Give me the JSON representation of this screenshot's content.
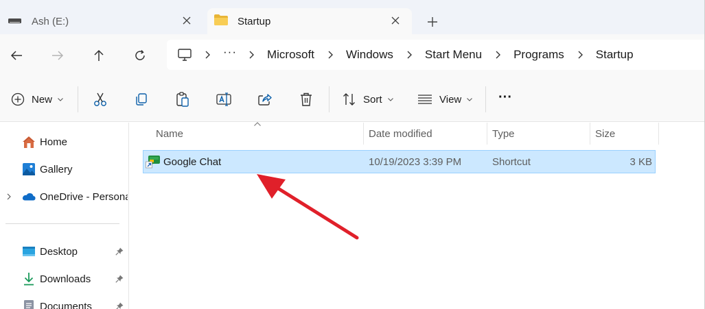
{
  "tabs": [
    {
      "label": "Ash (E:)",
      "icon": "drive-icon",
      "active": false
    },
    {
      "label": "Startup",
      "icon": "folder-icon",
      "active": true
    }
  ],
  "navigation": {
    "back": "back-arrow-icon",
    "forward": "forward-arrow-icon",
    "up": "up-arrow-icon",
    "refresh": "refresh-icon"
  },
  "breadcrumb": {
    "root_icon": "monitor-icon",
    "more": "···",
    "items": [
      "Microsoft",
      "Windows",
      "Start Menu",
      "Programs",
      "Startup"
    ]
  },
  "toolbar": {
    "new_label": "New",
    "sort_label": "Sort",
    "view_label": "View",
    "more_label": "···",
    "icons": [
      "cut-icon",
      "copy-icon",
      "paste-icon",
      "rename-icon",
      "share-icon",
      "delete-icon"
    ]
  },
  "sidebar": {
    "items": [
      {
        "label": "Home",
        "icon": "home-icon"
      },
      {
        "label": "Gallery",
        "icon": "gallery-icon"
      },
      {
        "label": "OneDrive - Persona",
        "icon": "onedrive-icon"
      },
      {
        "label": "Desktop",
        "icon": "desktop-icon",
        "pinned": true
      },
      {
        "label": "Downloads",
        "icon": "download-icon",
        "pinned": true
      },
      {
        "label": "Documents",
        "icon": "documents-icon",
        "pinned": true
      }
    ]
  },
  "columns": {
    "name": "Name",
    "date": "Date modified",
    "type": "Type",
    "size": "Size"
  },
  "files": [
    {
      "name": "Google Chat",
      "date": "10/19/2023 3:39 PM",
      "type": "Shortcut",
      "size": "3 KB",
      "selected": true
    }
  ],
  "colors": {
    "selection_bg": "#cce8ff",
    "selection_border": "#99d1ff",
    "annotation_arrow": "#e0202a",
    "chrome_bg": "#f0f3f9"
  }
}
